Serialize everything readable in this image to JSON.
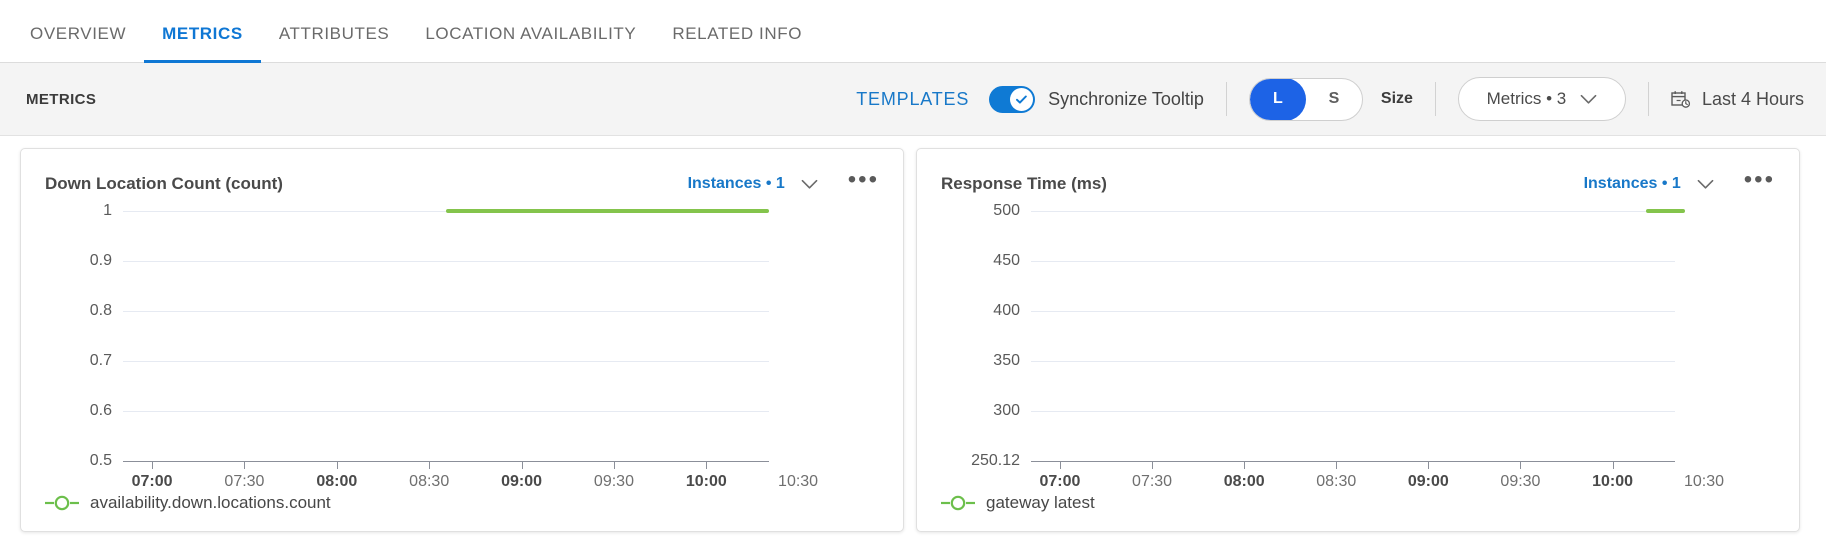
{
  "tabs": [
    {
      "label": "OVERVIEW",
      "active": false
    },
    {
      "label": "METRICS",
      "active": true
    },
    {
      "label": "ATTRIBUTES",
      "active": false
    },
    {
      "label": "LOCATION AVAILABILITY",
      "active": false
    },
    {
      "label": "RELATED INFO",
      "active": false
    }
  ],
  "toolbar": {
    "title": "METRICS",
    "templates_label": "TEMPLATES",
    "sync_tooltip_label": "Synchronize Tooltip",
    "sync_tooltip_on": true,
    "size_options": [
      "L",
      "S"
    ],
    "size_selected": "L",
    "size_caption": "Size",
    "metrics_selector": "Metrics • 3",
    "time_range": "Last 4 Hours",
    "accent_color": "#1878c8",
    "toggle_color": "#0f7ad4",
    "segment_color": "#1d63e6"
  },
  "cards": [
    {
      "title": "Down Location Count (count)",
      "instances": "Instances • 1",
      "menu": "•••",
      "legend": "availability.down.locations.count",
      "series_color": "#84c44c"
    },
    {
      "title": "Response Time (ms)",
      "instances": "Instances • 1",
      "menu": "•••",
      "legend": "gateway latest",
      "series_color": "#84c44c"
    }
  ],
  "chart_data": [
    {
      "type": "line",
      "title": "Down Location Count (count)",
      "ylabel": "count",
      "xlabel": "",
      "yticks": [
        "1",
        "0.9",
        "0.8",
        "0.7",
        "0.6",
        "0.5"
      ],
      "ylim": [
        0.5,
        1
      ],
      "xticks": [
        "07:00",
        "07:30",
        "08:00",
        "08:30",
        "09:00",
        "09:30",
        "10:00",
        "10:30"
      ],
      "xticks_bold": [
        "07:00",
        "08:00",
        "09:00",
        "10:00"
      ],
      "grid": true,
      "legend": [
        "availability.down.locations.count"
      ],
      "legend_position": "bottom-left",
      "series": [
        {
          "name": "availability.down.locations.count",
          "color": "#84c44c",
          "x_start_fraction": 0.5,
          "x_end_fraction": 1.0,
          "value": 1
        }
      ]
    },
    {
      "type": "line",
      "title": "Response Time (ms)",
      "ylabel": "ms",
      "xlabel": "",
      "yticks": [
        "500",
        "450",
        "400",
        "350",
        "300",
        "250.12"
      ],
      "ylim": [
        250.12,
        500
      ],
      "xticks": [
        "07:00",
        "07:30",
        "08:00",
        "08:30",
        "09:00",
        "09:30",
        "10:00",
        "10:30"
      ],
      "xticks_bold": [
        "07:00",
        "08:00",
        "09:00",
        "10:00"
      ],
      "grid": true,
      "legend": [
        "gateway latest"
      ],
      "legend_position": "bottom-left",
      "series": [
        {
          "name": "gateway latest",
          "color": "#84c44c",
          "x_start_fraction": 0.955,
          "x_end_fraction": 1.0,
          "value": 500
        }
      ]
    }
  ]
}
